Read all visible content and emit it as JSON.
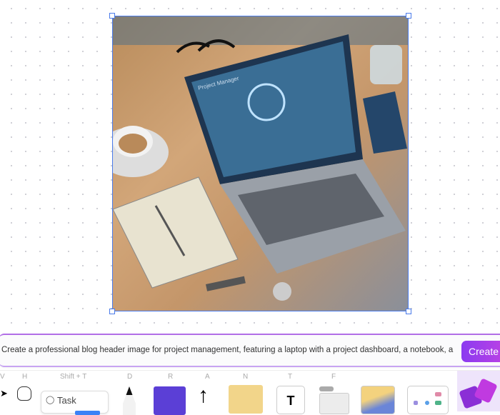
{
  "canvas": {
    "image_alt_text": "Project Manager"
  },
  "prompt": {
    "value": "Create a professional blog header image for project management, featuring a laptop with a project dashboard, a notebook, and",
    "button": "Create"
  },
  "toolbar": {
    "keys": {
      "select": "V",
      "hand": "H",
      "task": "Shift + T",
      "draw": "D",
      "rect": "R",
      "arrow": "A",
      "note": "N",
      "text": "T",
      "frame": "F"
    },
    "task_label": "Task",
    "text_glyph": "T"
  },
  "colors": {
    "selection": "#4a7bea",
    "accent": "#8b3bf0",
    "rect": "#5b3fd6",
    "note": "#f2d58a"
  }
}
